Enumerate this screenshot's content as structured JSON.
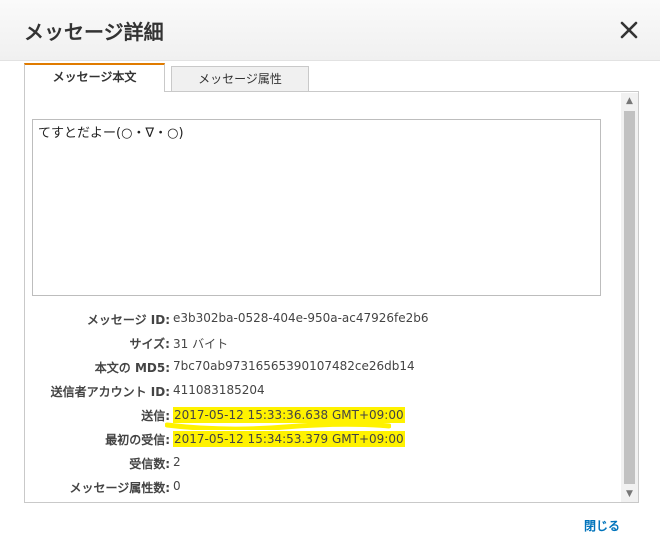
{
  "dialog": {
    "title": "メッセージ詳細",
    "close_icon": "close-x-icon",
    "close_label": "閉じる"
  },
  "tabs": [
    {
      "label": "メッセージ本文",
      "active": true
    },
    {
      "label": "メッセージ属性",
      "active": false
    }
  ],
  "message": {
    "body": "てすとだよー(○・∇・○)"
  },
  "attributes": [
    {
      "label": "メッセージ ID:",
      "value": "e3b302ba-0528-404e-950a-ac47926fe2b6",
      "highlight": false
    },
    {
      "label": "サイズ:",
      "value": "31 バイト",
      "highlight": false
    },
    {
      "label": "本文の MD5:",
      "value": "7bc70ab97316565390107482ce26db14",
      "highlight": false
    },
    {
      "label": "送信者アカウント ID:",
      "value": "411083185204",
      "highlight": false
    },
    {
      "label": "送信:",
      "value": "2017-05-12 15:33:36.638 GMT+09:00",
      "highlight": true
    },
    {
      "label": "最初の受信:",
      "value": "2017-05-12 15:34:53.379 GMT+09:00",
      "highlight": true
    },
    {
      "label": "受信数:",
      "value": "2",
      "highlight": false
    },
    {
      "label": "メッセージ属性数:",
      "value": "0",
      "highlight": false
    }
  ],
  "colors": {
    "tab_accent": "#e07b00",
    "link": "#0073bb",
    "highlight": "#fff200"
  }
}
